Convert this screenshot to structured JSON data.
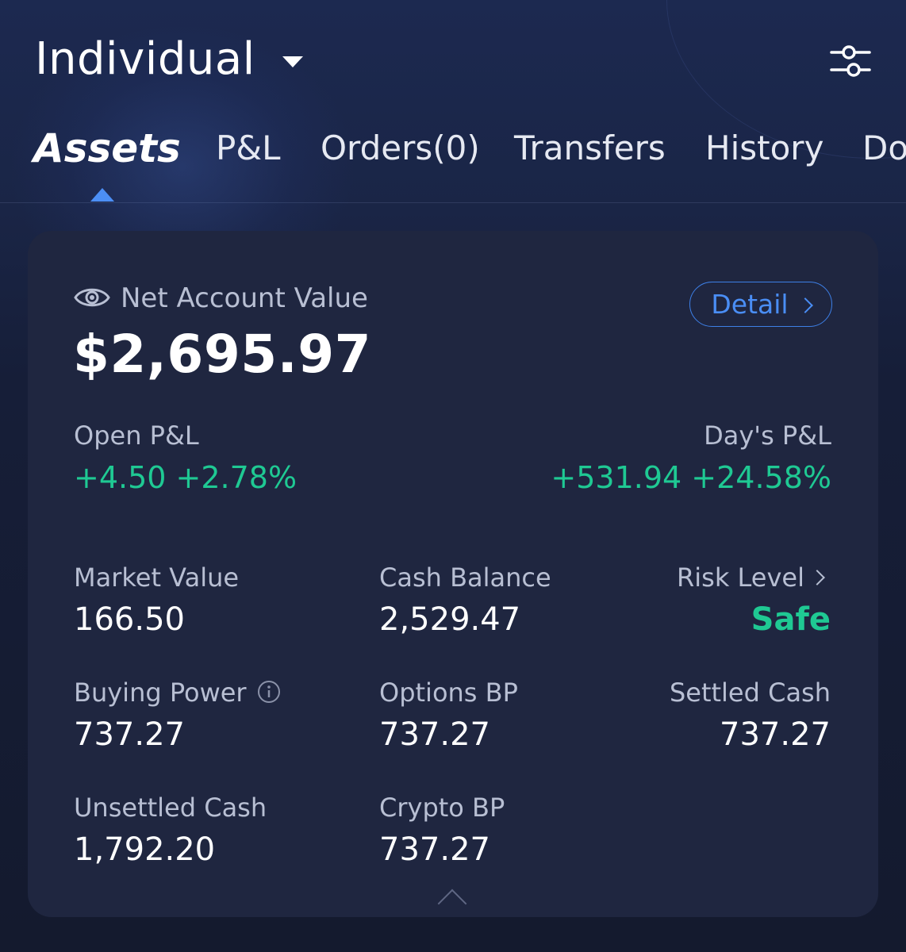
{
  "header": {
    "account_name": "Individual",
    "caret_icon": "caret-down-icon",
    "settings_icon": "sliders-icon"
  },
  "tabs": [
    {
      "label": "Assets",
      "active": true
    },
    {
      "label": "P&L"
    },
    {
      "label": "Orders(0)"
    },
    {
      "label": "Transfers"
    },
    {
      "label": "History"
    },
    {
      "label": "Do"
    }
  ],
  "summary": {
    "eye_icon": "eye-icon",
    "net_account_value_label": "Net Account Value",
    "net_account_value": "$2,695.97",
    "detail_label": "Detail",
    "open_pl_label": "Open P&L",
    "open_pl_value": "+4.50 +2.78%",
    "days_pl_label": "Day's P&L",
    "days_pl_value": "+531.94 +24.58%"
  },
  "metrics": {
    "market_value_label": "Market Value",
    "market_value": "166.50",
    "cash_balance_label": "Cash Balance",
    "cash_balance": "2,529.47",
    "risk_level_label": "Risk Level",
    "risk_level": "Safe",
    "buying_power_label": "Buying Power",
    "buying_power": "737.27",
    "options_bp_label": "Options BP",
    "options_bp": "737.27",
    "settled_cash_label": "Settled Cash",
    "settled_cash": "737.27",
    "unsettled_cash_label": "Unsettled Cash",
    "unsettled_cash": "1,792.20",
    "crypto_bp_label": "Crypto BP",
    "crypto_bp": "737.27"
  },
  "colors": {
    "accent_blue": "#4a8ef5",
    "gain_green": "#1fc993",
    "card_bg": "#1f2640"
  }
}
